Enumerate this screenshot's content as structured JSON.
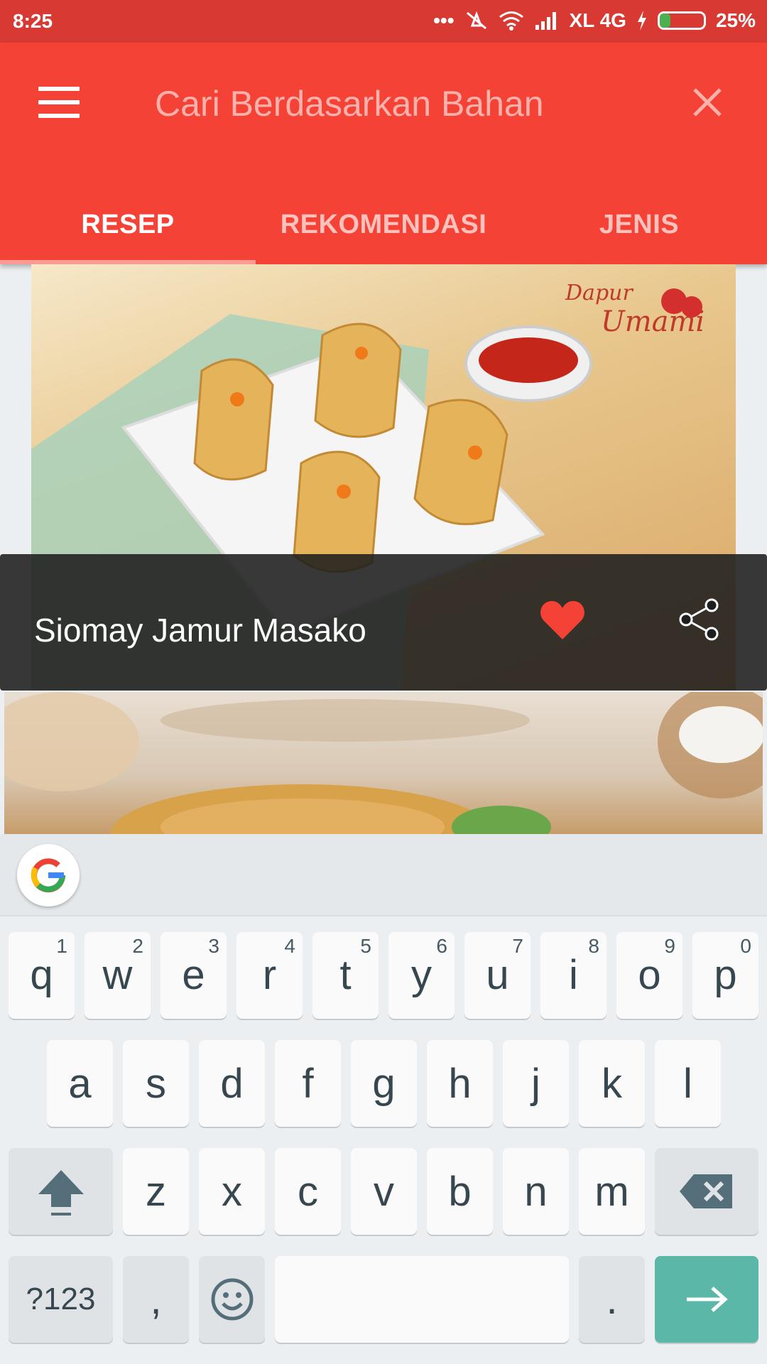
{
  "status_bar": {
    "time": "8:25",
    "carrier": "XL 4G",
    "battery": "25%"
  },
  "toolbar": {
    "search_placeholder": "Cari Berdasarkan Bahan"
  },
  "tabs": [
    {
      "label": "RESEP",
      "active": true
    },
    {
      "label": "REKOMENDASI",
      "active": false
    },
    {
      "label": "JENIS",
      "active": false
    }
  ],
  "recipes": [
    {
      "title": "Siomay Jamur Masako",
      "brand_watermark": "Dapur Umami",
      "favorited": true
    }
  ],
  "keyboard": {
    "row1": [
      {
        "label": "q",
        "hint": "1"
      },
      {
        "label": "w",
        "hint": "2"
      },
      {
        "label": "e",
        "hint": "3"
      },
      {
        "label": "r",
        "hint": "4"
      },
      {
        "label": "t",
        "hint": "5"
      },
      {
        "label": "y",
        "hint": "6"
      },
      {
        "label": "u",
        "hint": "7"
      },
      {
        "label": "i",
        "hint": "8"
      },
      {
        "label": "o",
        "hint": "9"
      },
      {
        "label": "p",
        "hint": "0"
      }
    ],
    "row2": [
      "a",
      "s",
      "d",
      "f",
      "g",
      "h",
      "j",
      "k",
      "l"
    ],
    "row3": [
      "z",
      "x",
      "c",
      "v",
      "b",
      "n",
      "m"
    ],
    "symbols_label": "?123",
    "comma_label": ",",
    "period_label": "."
  },
  "colors": {
    "status_bar": "#d83a33",
    "toolbar": "#f44336",
    "heart": "#f44336",
    "enter_key": "#5bb8a8"
  }
}
